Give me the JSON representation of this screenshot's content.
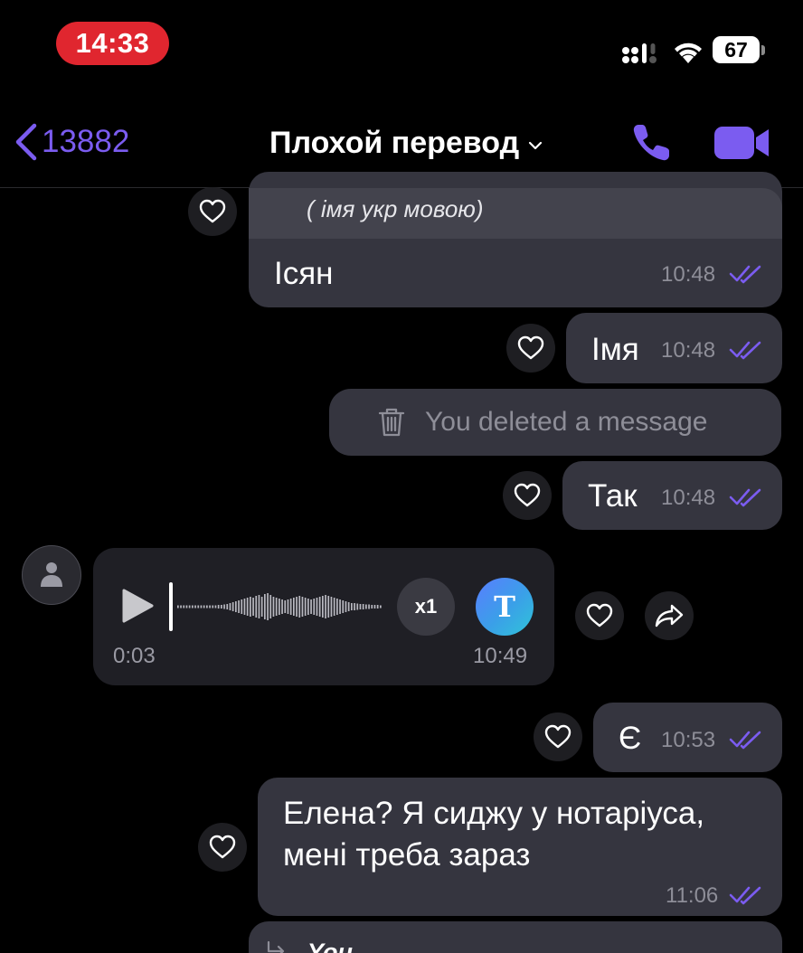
{
  "status_bar": {
    "time": "14:33",
    "battery": "67"
  },
  "header": {
    "back_count": "13882",
    "title": "Плохой перевод"
  },
  "messages": {
    "quoted_fragment": "( імя укр мовою)",
    "m1": {
      "text": "Ісян",
      "time": "10:48"
    },
    "m2": {
      "text": "Імя",
      "time": "10:48"
    },
    "deleted": {
      "text": "You deleted a message"
    },
    "m3": {
      "text": "Так",
      "time": "10:48"
    },
    "voice": {
      "duration": "0:03",
      "time": "10:49",
      "speed_label": "x1",
      "transcribe_label": "T"
    },
    "m4": {
      "text": "Є",
      "time": "10:53"
    },
    "m5": {
      "line1": "Елена? Я сиджу у нотаріуса,",
      "line2": "мені треба зараз",
      "time": "11:06"
    },
    "partial_reply_label": "You"
  },
  "colors": {
    "accent": "#7b5cf0",
    "bubble": "#35353f",
    "status_pill": "#e0262f",
    "background": "#000000"
  },
  "icons": [
    "back-chevron-icon",
    "chevron-down-icon",
    "phone-icon",
    "video-camera-icon",
    "heart-icon",
    "trash-icon",
    "play-icon",
    "share-icon",
    "double-check-icon",
    "user-avatar-icon",
    "signal-icon",
    "wifi-icon",
    "battery-icon"
  ]
}
